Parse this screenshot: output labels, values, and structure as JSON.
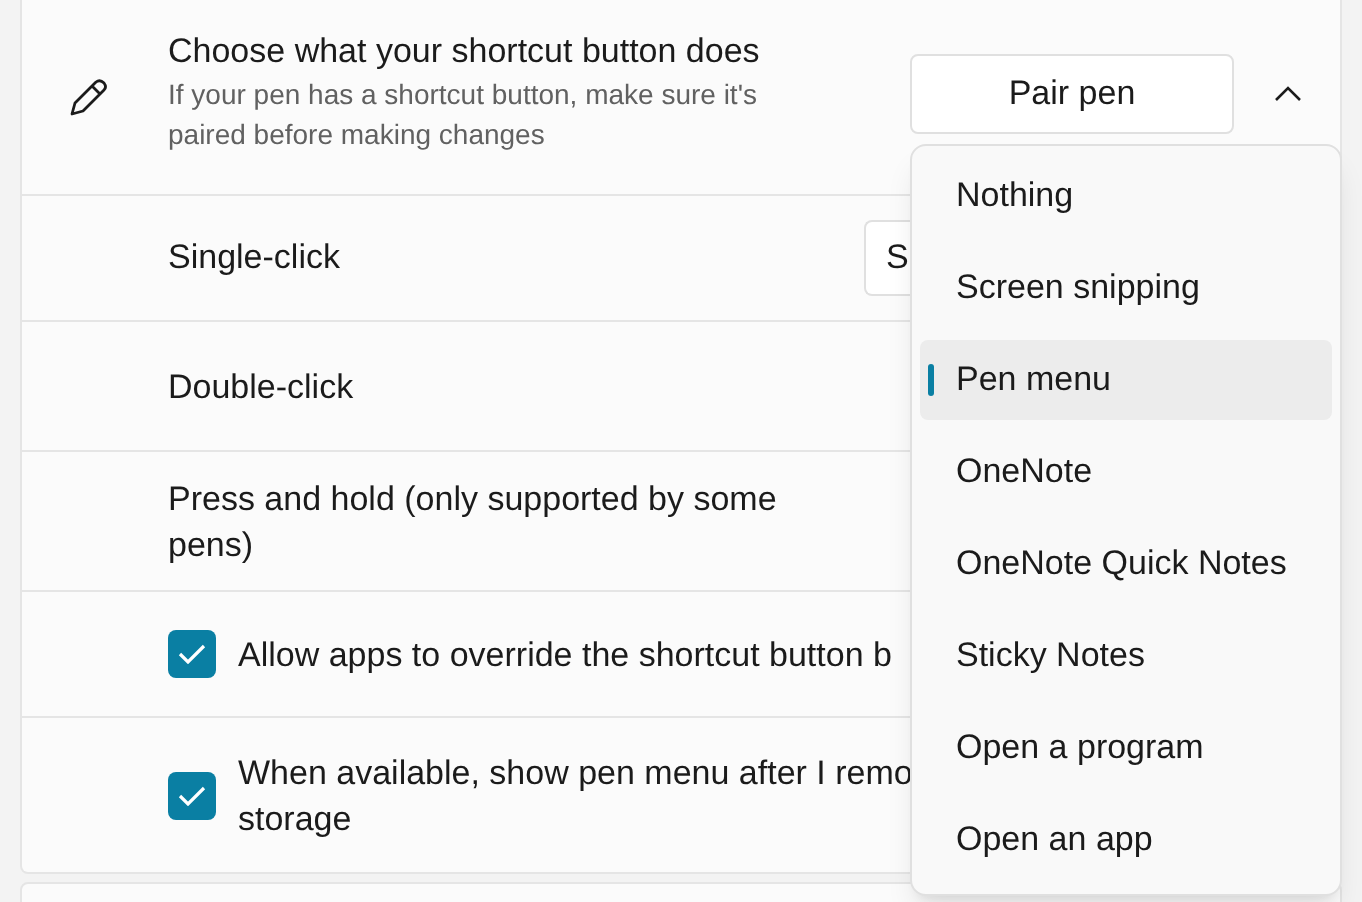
{
  "header": {
    "title": "Choose what your shortcut button does",
    "description": "If your pen has a shortcut button, make sure it's paired before making changes",
    "button": "Pair pen",
    "expanded": true
  },
  "rows": [
    {
      "kind": "select",
      "label": "Single-click",
      "value": "S"
    },
    {
      "kind": "plain",
      "label": "Double-click"
    },
    {
      "kind": "plain",
      "label": "Press and hold (only supported by some pens)"
    },
    {
      "kind": "checkbox",
      "label": "Allow apps to override the shortcut button b",
      "checked": true
    },
    {
      "kind": "checkbox",
      "label": "When available, show pen menu after I remo storage",
      "checked": true
    }
  ],
  "menu": [
    {
      "label": "Nothing",
      "selected": false
    },
    {
      "label": "Screen snipping",
      "selected": false
    },
    {
      "label": "Pen menu",
      "selected": true
    },
    {
      "label": "OneNote",
      "selected": false
    },
    {
      "label": "OneNote Quick Notes",
      "selected": false
    },
    {
      "label": "Sticky Notes",
      "selected": false
    },
    {
      "label": "Open a program",
      "selected": false
    },
    {
      "label": "Open an app",
      "selected": false
    }
  ]
}
